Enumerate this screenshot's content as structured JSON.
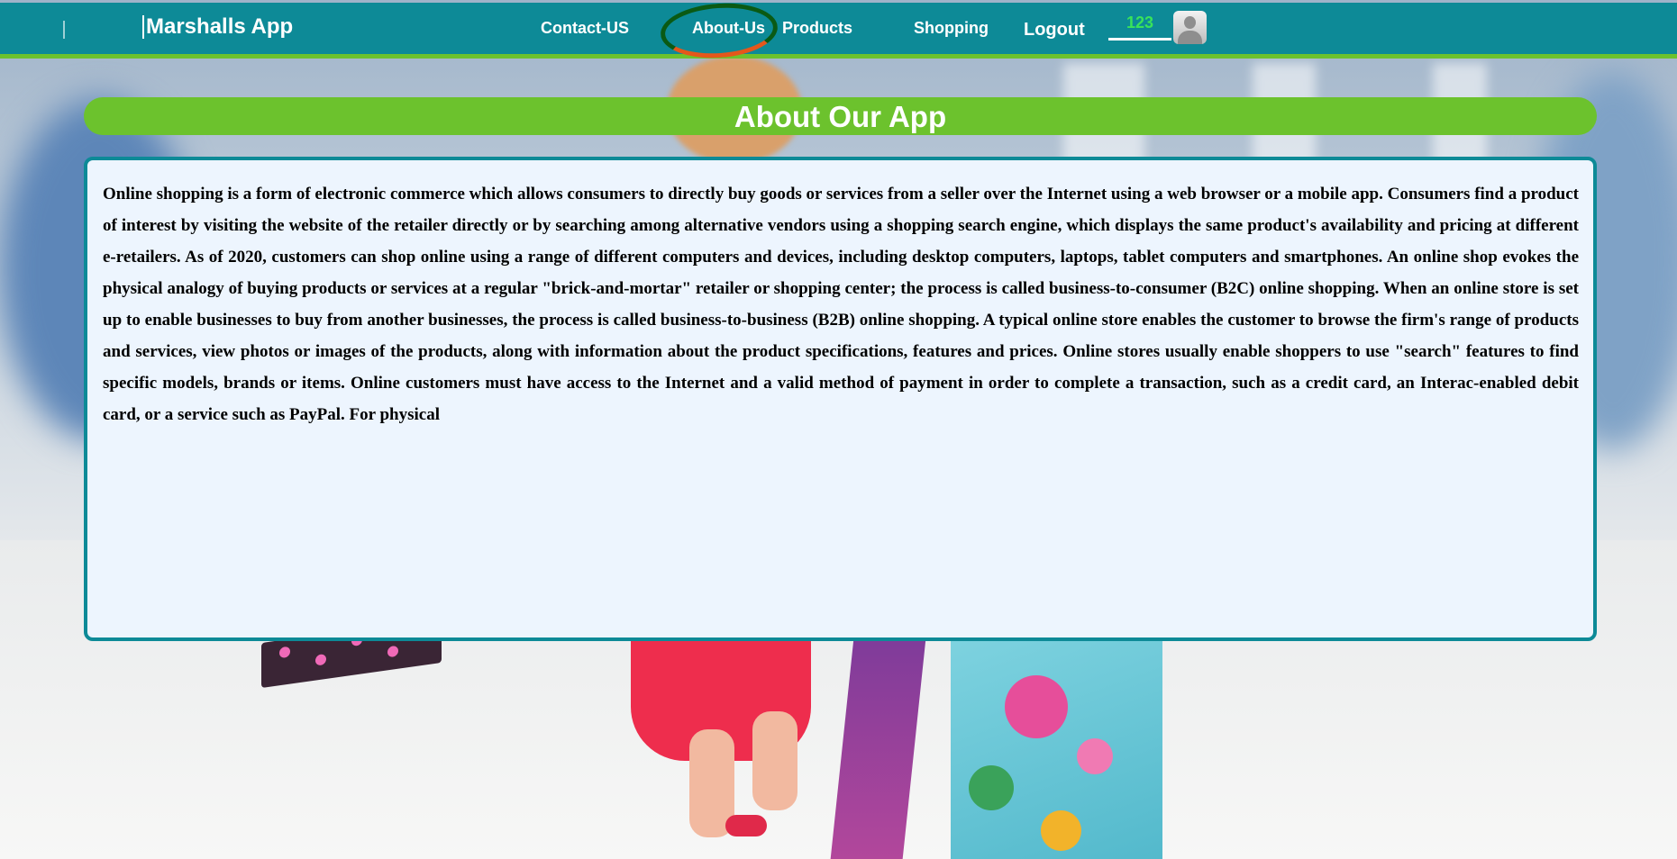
{
  "nav": {
    "brand": "Marshalls App",
    "links": [
      {
        "label": "Contact-US"
      },
      {
        "label": "About-Us"
      },
      {
        "label": "Products"
      },
      {
        "label": "Shopping"
      },
      {
        "label": "Logout"
      }
    ],
    "counter": "123",
    "avatar_icon": "user-avatar-icon"
  },
  "main": {
    "title": "About Our App",
    "body": "Online shopping is a form of electronic commerce which allows consumers to directly buy goods or services from a seller over the Internet using a web browser or a mobile app. Consumers find a product of interest by visiting the website of the retailer directly or by searching among alternative vendors using a shopping search engine, which displays the same product's availability and pricing at different e-retailers. As of 2020, customers can shop online using a range of different computers and devices, including desktop computers, laptops, tablet computers and smartphones. An online shop evokes the physical analogy of buying products or services at a regular \"brick-and-mortar\" retailer or shopping center; the process is called business-to-consumer (B2C) online shopping. When an online store is set up to enable businesses to buy from another businesses, the process is called business-to-business (B2B) online shopping. A typical online store enables the customer to browse the firm's range of products and services, view photos or images of the products, along with information about the product specifications, features and prices. Online stores usually enable shoppers to use \"search\" features to find specific models, brands or items. Online customers must have access to the Internet and a valid method of payment in order to complete a transaction, such as a credit card, an Interac-enabled debit card, or a service such as PayPal. For physical"
  },
  "colors": {
    "nav_bg": "#0d8a97",
    "accent_green": "#6cc22d",
    "card_bg": "#edf5fe",
    "counter_text": "#39e35a"
  }
}
